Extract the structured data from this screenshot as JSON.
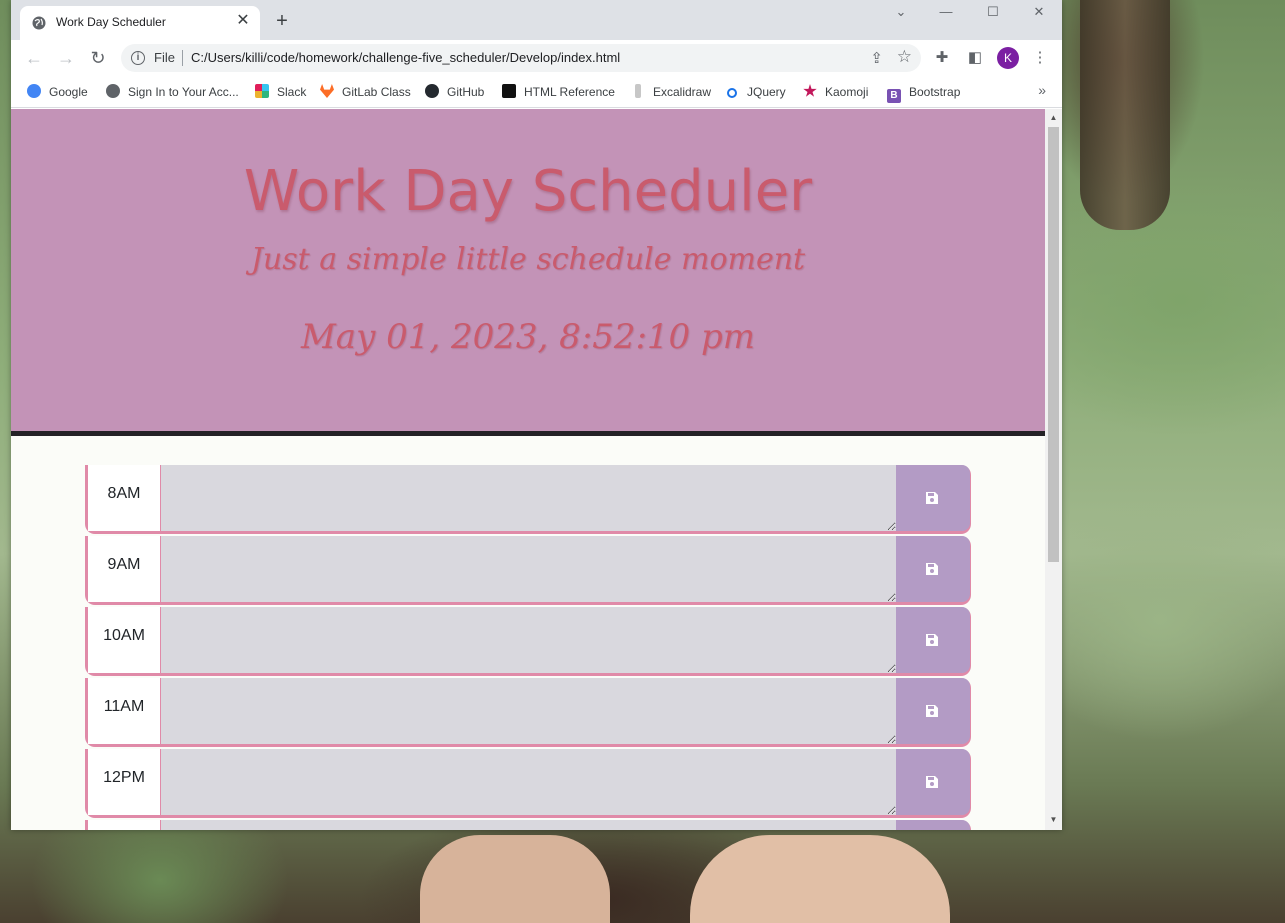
{
  "browser": {
    "tab_title": "Work Day Scheduler",
    "new_tab_label": "+",
    "url_scheme_label": "File",
    "url": "C:/Users/killi/code/homework/challenge-five_scheduler/Develop/index.html",
    "profile_initial": "K",
    "accent_color": "#7b1fa2"
  },
  "bookmarks": [
    {
      "label": "Google",
      "icon": "google-icon",
      "color": "#4285f4"
    },
    {
      "label": "Sign In to Your Acc...",
      "icon": "globe-icon",
      "color": "#5f6368"
    },
    {
      "label": "Slack",
      "icon": "slack-icon",
      "color": "#e01e5a"
    },
    {
      "label": "GitLab Class",
      "icon": "gitlab-icon",
      "color": "#fc6d26"
    },
    {
      "label": "GitHub",
      "icon": "github-icon",
      "color": "#24292f"
    },
    {
      "label": "HTML Reference",
      "icon": "html-reference-icon",
      "color": "#111111"
    },
    {
      "label": "Excalidraw",
      "icon": "excalidraw-icon",
      "color": "#9a9a9a"
    },
    {
      "label": "JQuery",
      "icon": "search-icon",
      "color": "#1a73e8"
    },
    {
      "label": "Kaomoji",
      "icon": "kaomoji-icon",
      "color": "#c2185b"
    },
    {
      "label": "Bootstrap",
      "icon": "bootstrap-icon",
      "color": "#7952b3"
    }
  ],
  "page": {
    "title": "Work Day Scheduler",
    "subtitle": "Just a simple little schedule moment",
    "current_datetime": "May 01, 2023, 8:52:10 pm",
    "colors": {
      "header_bg": "#c393b7",
      "title_color": "#c95b6d",
      "row_border": "#e08aa8",
      "textarea_bg": "#d9d8de",
      "save_bg": "#b39bc5"
    }
  },
  "time_blocks": [
    {
      "hour": "8AM",
      "text": ""
    },
    {
      "hour": "9AM",
      "text": ""
    },
    {
      "hour": "10AM",
      "text": ""
    },
    {
      "hour": "11AM",
      "text": ""
    },
    {
      "hour": "12PM",
      "text": ""
    }
  ]
}
